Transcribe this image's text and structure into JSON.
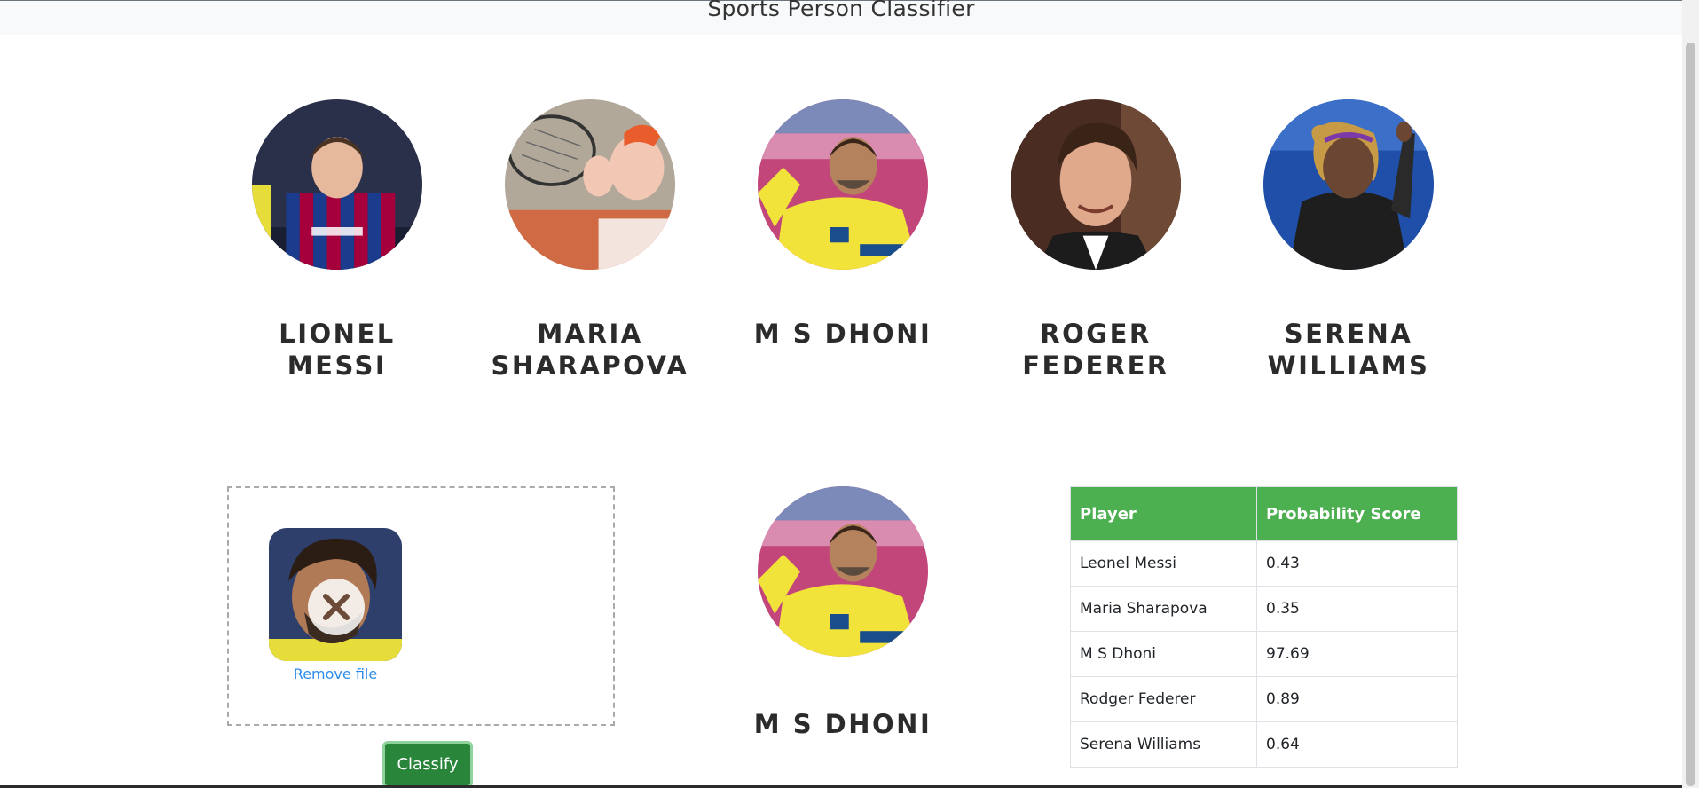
{
  "app": {
    "title": "Sports Person Classifier"
  },
  "players": [
    {
      "name": "LIONEL\nMESSI",
      "photo": "messi-photo"
    },
    {
      "name": "MARIA\nSHARAPOVA",
      "photo": "sharapova-photo"
    },
    {
      "name": "M S DHONI",
      "photo": "dhoni-photo"
    },
    {
      "name": "ROGER\nFEDERER",
      "photo": "federer-photo"
    },
    {
      "name": "SERENA\nWILLIAMS",
      "photo": "serena-photo"
    }
  ],
  "upload": {
    "remove_label": "Remove file",
    "classify_label": "Classify"
  },
  "result": {
    "name": "M S DHONI"
  },
  "table": {
    "headers": [
      "Player",
      "Probability Score"
    ],
    "rows": [
      {
        "player": "Leonel Messi",
        "score": "0.43"
      },
      {
        "player": "Maria Sharapova",
        "score": "0.35"
      },
      {
        "player": "M S Dhoni",
        "score": "97.69"
      },
      {
        "player": "Rodger Federer",
        "score": "0.89"
      },
      {
        "player": "Serena Williams",
        "score": "0.64"
      }
    ]
  },
  "colors": {
    "accent": "#4caf50",
    "button": "#28853a",
    "link": "#2d8ceb"
  }
}
